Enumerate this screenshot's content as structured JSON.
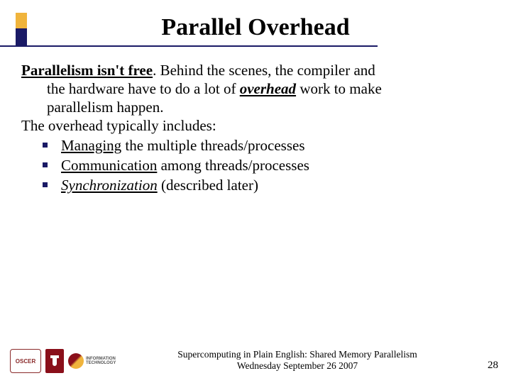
{
  "title": "Parallel Overhead",
  "lead": {
    "strong_u": "Parallelism isn't free",
    "after_period": ".  Behind the scenes, the compiler and",
    "line2": "the hardware have to do a lot of ",
    "overhead_word": "overhead",
    "line2_tail": " work to make",
    "line3": "parallelism happen."
  },
  "list_intro": "The overhead typically includes:",
  "bullets": [
    {
      "u": "Managing",
      "rest": " the multiple threads/processes"
    },
    {
      "u": "Communication",
      "rest": " among threads/processes"
    },
    {
      "u_i": "Synchronization",
      "rest": " (described later)"
    }
  ],
  "footer": {
    "line1": "Supercomputing in Plain English: Shared Memory Parallelism",
    "line2": "Wednesday September 26 2007"
  },
  "slide_number": "28",
  "logos": {
    "oscer": "OSCER",
    "ou": "OU",
    "it1": "INFORMATION",
    "it2": "TECHNOLOGY"
  }
}
